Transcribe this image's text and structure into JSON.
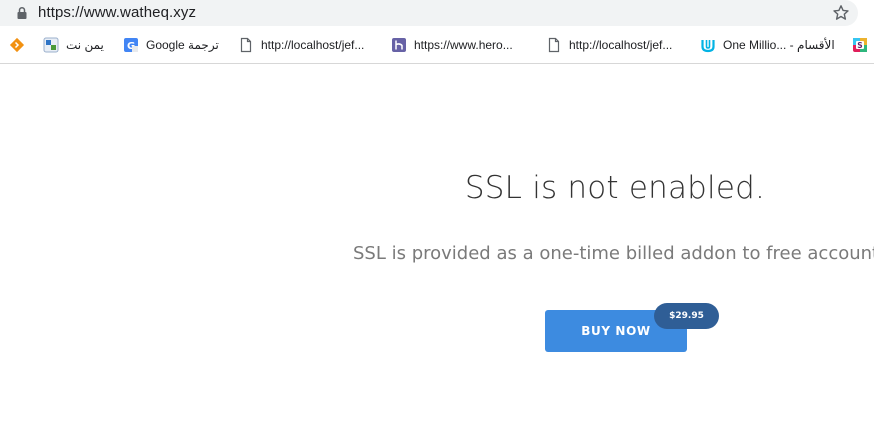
{
  "browser": {
    "url": "https://www.watheq.xyz"
  },
  "bookmarks": [
    {
      "label": "",
      "icon": "orange-diamond-icon"
    },
    {
      "label": "يمن نت",
      "icon": "yemennet-icon"
    },
    {
      "label": "Google ترجمة",
      "icon": "google-translate-icon"
    },
    {
      "label": "http://localhost/jef...",
      "icon": "page-icon"
    },
    {
      "label": "https://www.hero...",
      "icon": "heroku-icon"
    },
    {
      "label": "http://localhost/jef...",
      "icon": "page-icon"
    },
    {
      "label": "One Millio... - الأقسام",
      "icon": "udacity-icon"
    },
    {
      "label": "",
      "icon": "slack-icon"
    }
  ],
  "main": {
    "headline": "SSL is not enabled.",
    "subline": "SSL is provided as a one-time billed addon to free accounts",
    "buy_label": "BUY NOW",
    "price": "$29.95"
  },
  "colors": {
    "button": "#3d8be0",
    "price_badge": "#2f5e96"
  }
}
